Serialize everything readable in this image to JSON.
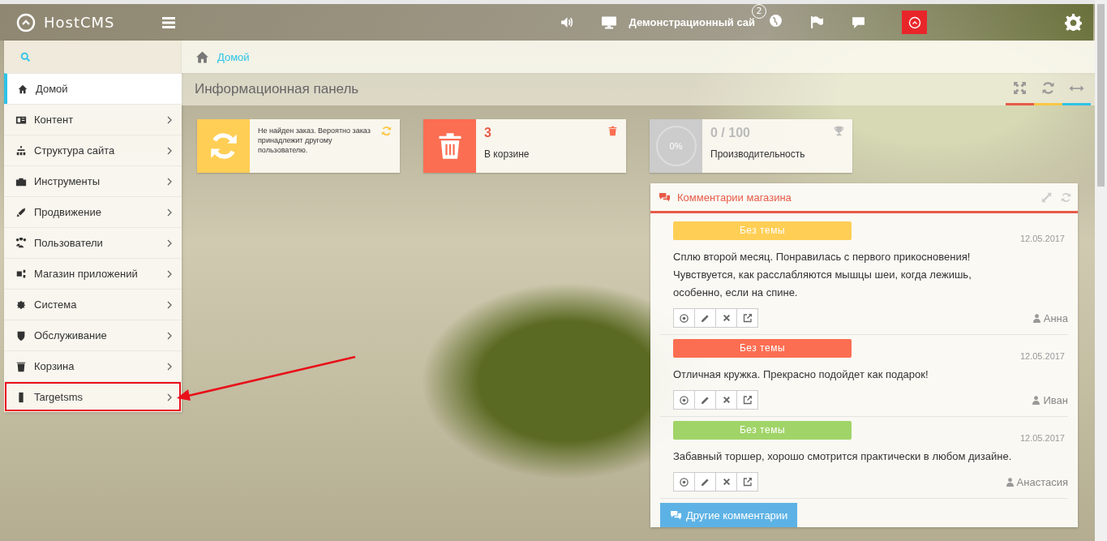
{
  "topbar": {
    "logo": "HostCMS",
    "site_name": "Демонстрационный сай",
    "notification_count": "2"
  },
  "sidebar": {
    "items": [
      {
        "label": "Домой",
        "selected": true,
        "has_submenu": false,
        "annotated": false
      },
      {
        "label": "Контент",
        "selected": false,
        "has_submenu": true,
        "annotated": false
      },
      {
        "label": "Структура сайта",
        "selected": false,
        "has_submenu": true,
        "annotated": false
      },
      {
        "label": "Инструменты",
        "selected": false,
        "has_submenu": true,
        "annotated": false
      },
      {
        "label": "Продвижение",
        "selected": false,
        "has_submenu": true,
        "annotated": false
      },
      {
        "label": "Пользователи",
        "selected": false,
        "has_submenu": true,
        "annotated": false
      },
      {
        "label": "Магазин приложений",
        "selected": false,
        "has_submenu": true,
        "annotated": false
      },
      {
        "label": "Система",
        "selected": false,
        "has_submenu": true,
        "annotated": false
      },
      {
        "label": "Обслуживание",
        "selected": false,
        "has_submenu": true,
        "annotated": false
      },
      {
        "label": "Корзина",
        "selected": false,
        "has_submenu": true,
        "annotated": false
      },
      {
        "label": "Targetsms",
        "selected": false,
        "has_submenu": true,
        "annotated": true
      }
    ]
  },
  "breadcrumb": "Домой",
  "page_title": "Информационная панель",
  "header_tools": [
    {
      "color": "#e75b48"
    },
    {
      "color": "#fbc746"
    },
    {
      "color": "#2dc3e8"
    }
  ],
  "widgets": [
    {
      "kind": "notice",
      "color": "#ffce55",
      "text": "Не найден заказ. Вероятно заказ принадлежит другому пользователю."
    },
    {
      "kind": "counter",
      "color": "#fb6e52",
      "value": "3",
      "label": "В корзине"
    },
    {
      "kind": "progress",
      "color": "#cccccc",
      "reading": "0%",
      "level": 0,
      "value": "0 / 100",
      "label": "Производительность"
    }
  ],
  "comments_panel": {
    "title": "Комментарии магазина",
    "more_button": "Другие комментарии",
    "comments": [
      {
        "tag": "Без темы",
        "color": "#ffce55",
        "date": "12.05.2017",
        "text": "Сплю второй месяц. Понравилась с первого прикосновения! Чувствуется, как расслабляются мышцы шеи, когда лежишь, особенно, если на спине.",
        "author": "Анна"
      },
      {
        "tag": "Без темы",
        "color": "#fb6e52",
        "date": "12.05.2017",
        "text": "Отличная кружка. Прекрасно подойдет как подарок!",
        "author": "Иван"
      },
      {
        "tag": "Без темы",
        "color": "#a0d468",
        "date": "12.05.2017",
        "text": "Забавный торшер, хорошо смотрится практически в любом дизайне.",
        "author": "Анастасия"
      }
    ]
  }
}
